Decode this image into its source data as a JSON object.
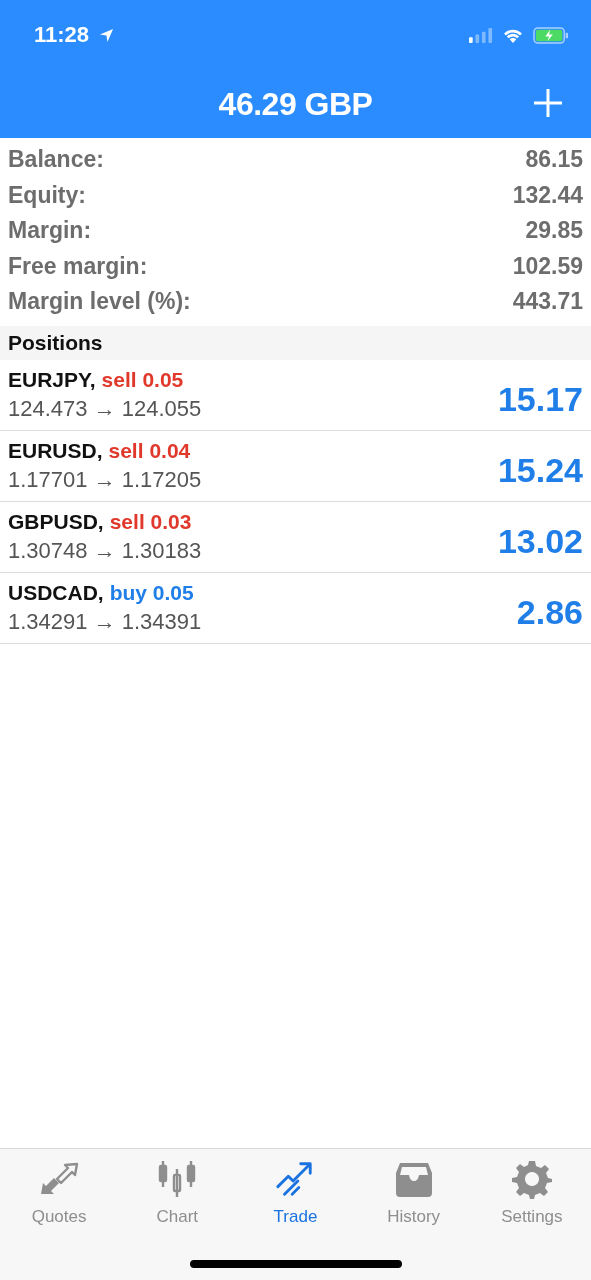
{
  "status_bar": {
    "time": "11:28"
  },
  "header": {
    "title": "46.29 GBP"
  },
  "summary": [
    {
      "label": "Balance:",
      "value": "86.15"
    },
    {
      "label": "Equity:",
      "value": "132.44"
    },
    {
      "label": "Margin:",
      "value": "29.85"
    },
    {
      "label": "Free margin:",
      "value": "102.59"
    },
    {
      "label": "Margin level (%):",
      "value": "443.71"
    }
  ],
  "positions_heading": "Positions",
  "positions": [
    {
      "symbol": "EURJPY,",
      "kind": "sell",
      "order": "sell 0.05",
      "prices": "124.473 → 124.055",
      "profit": "15.17"
    },
    {
      "symbol": "EURUSD,",
      "kind": "sell",
      "order": "sell 0.04",
      "prices": "1.17701 → 1.17205",
      "profit": "15.24"
    },
    {
      "symbol": "GBPUSD,",
      "kind": "sell",
      "order": "sell 0.03",
      "prices": "1.30748 → 1.30183",
      "profit": "13.02"
    },
    {
      "symbol": "USDCAD,",
      "kind": "buy",
      "order": "buy 0.05",
      "prices": "1.34291 → 1.34391",
      "profit": "2.86"
    }
  ],
  "tabs": [
    {
      "label": "Quotes",
      "kind": "quotes",
      "selected": false
    },
    {
      "label": "Chart",
      "kind": "chart",
      "selected": false
    },
    {
      "label": "Trade",
      "kind": "trade",
      "selected": true
    },
    {
      "label": "History",
      "kind": "history",
      "selected": false
    },
    {
      "label": "Settings",
      "kind": "settings",
      "selected": false
    }
  ]
}
